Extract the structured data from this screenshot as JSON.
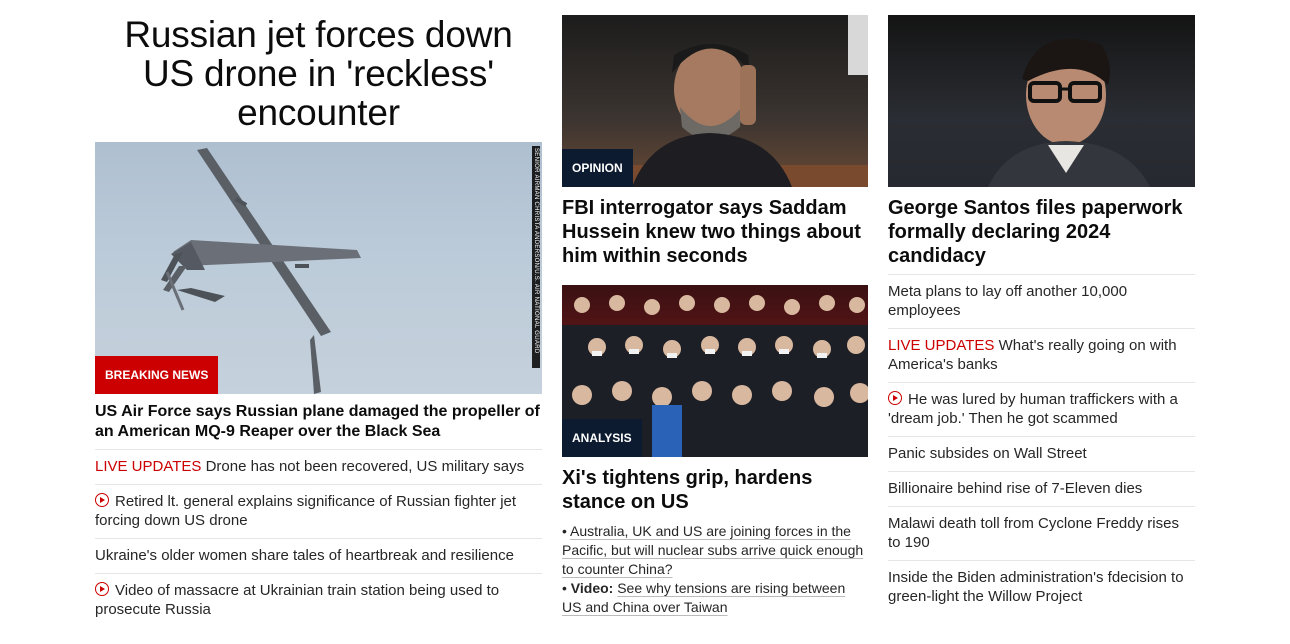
{
  "lead": {
    "headline": "Russian jet forces down US drone in 'reckless' encounter",
    "image_credit": "SENIOR AIRMAN CHRISTA ANDERSON/U.S. AIR NATIONAL GUARD",
    "label": "BREAKING NEWS",
    "story_title": "US Air Force says Russian plane damaged the propeller of an American MQ-9 Reaper over the Black Sea",
    "related": [
      {
        "prefix": "LIVE UPDATES",
        "text": "Drone has not been recovered, US military says"
      },
      {
        "video": true,
        "text": "Retired lt. general explains significance of Russian fighter jet forcing down US drone"
      },
      {
        "text": "Ukraine's older women share tales of heartbreak and resilience"
      },
      {
        "video": true,
        "text": "Video of massacre at Ukrainian train station being used to prosecute Russia"
      }
    ]
  },
  "middle": {
    "story1": {
      "label": "OPINION",
      "title": "FBI interrogator says Saddam Hussein knew two things about him within seconds"
    },
    "story2": {
      "label": "ANALYSIS",
      "title": "Xi's tightens grip, hardens stance on US",
      "bullet1": "Australia, UK and US are joining forces in the Pacific, but will nuclear subs arrive quick enough to counter China?",
      "bullet2_prefix": "Video:",
      "bullet2": "See why tensions are rising between US and China over Taiwan"
    }
  },
  "right": {
    "title": "George Santos files paperwork formally declaring 2024 candidacy",
    "list": [
      {
        "text": "Meta plans to lay off another 10,000 employees"
      },
      {
        "prefix": "LIVE UPDATES",
        "text": "What's really going on with America's banks"
      },
      {
        "video": true,
        "text": "He was lured by human traffickers with a 'dream job.' Then he got scammed"
      },
      {
        "text": "Panic subsides on Wall Street"
      },
      {
        "text": "Billionaire behind rise of 7-Eleven dies"
      },
      {
        "text": "Malawi death toll from Cyclone Freddy rises to 190"
      },
      {
        "text": "Inside the Biden administration's fdecision to green-light the Willow Project"
      }
    ]
  },
  "colors": {
    "accent_red": "#cc0000",
    "label_dark": "#0c1b2f"
  }
}
